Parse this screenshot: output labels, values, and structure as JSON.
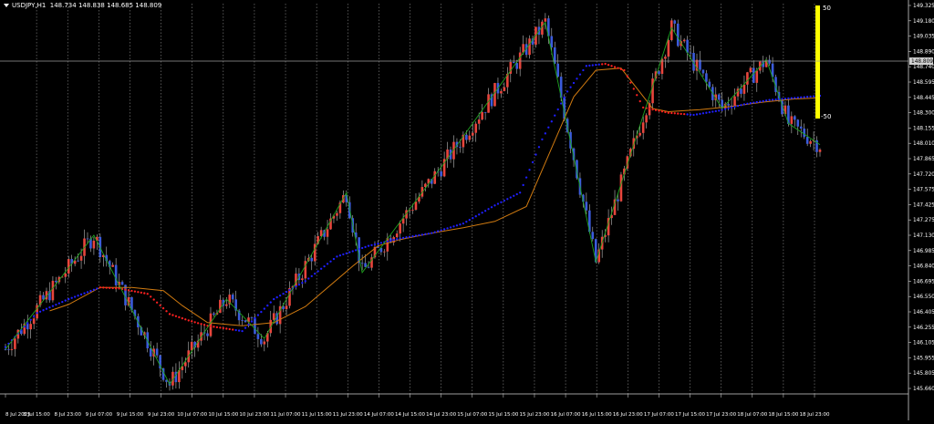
{
  "window": {
    "symbol": "USDJPY,H1",
    "ohlc_values": "148.734 148.838 148.685 148.809",
    "current_price_label": "148.809"
  },
  "indicator": {
    "top_label": "50",
    "bottom_label": "-50",
    "bar_color": "#ffff00"
  },
  "colors": {
    "background": "#000000",
    "bull": "#e8453c",
    "bear": "#3b5bdb",
    "zigzag": "#1fa31f",
    "ma_blue": "#1f1fff",
    "ma_red": "#ff2020",
    "ma_orange": "#d07a10"
  },
  "chart_data": {
    "type": "candlestick",
    "y_ticks": [
      "149.325",
      "149.180",
      "149.035",
      "148.890",
      "148.740",
      "148.595",
      "148.445",
      "148.300",
      "148.155",
      "148.010",
      "147.865",
      "147.720",
      "147.575",
      "147.425",
      "147.275",
      "147.130",
      "146.985",
      "146.840",
      "146.695",
      "146.550",
      "146.405",
      "146.255",
      "146.105",
      "145.955",
      "145.805",
      "145.660"
    ],
    "ylim": [
      145.66,
      149.325
    ],
    "x_ticks": [
      "8 Jul 2025",
      "8 Jul 15:00",
      "8 Jul 23:00",
      "9 Jul 07:00",
      "9 Jul 15:00",
      "9 Jul 23:00",
      "10 Jul 07:00",
      "10 Jul 15:00",
      "10 Jul 23:00",
      "11 Jul 07:00",
      "11 Jul 15:00",
      "11 Jul 23:00",
      "14 Jul 07:00",
      "14 Jul 15:00",
      "14 Jul 23:00",
      "15 Jul 07:00",
      "15 Jul 15:00",
      "15 Jul 23:00",
      "16 Jul 07:00",
      "16 Jul 15:00",
      "16 Jul 23:00",
      "17 Jul 07:00",
      "17 Jul 15:00",
      "17 Jul 23:00",
      "18 Jul 07:00",
      "18 Jul 15:00",
      "18 Jul 23:00"
    ],
    "zigzag": [
      [
        0,
        146.08
      ],
      [
        28,
        147.15
      ],
      [
        52,
        145.75
      ],
      [
        70,
        146.55
      ],
      [
        82,
        146.18
      ],
      [
        108,
        147.55
      ],
      [
        113,
        146.8
      ],
      [
        139,
        147.83
      ],
      [
        171,
        149.15
      ],
      [
        187,
        146.9
      ],
      [
        211,
        149.1
      ],
      [
        227,
        148.34
      ],
      [
        241,
        148.8
      ],
      [
        248,
        148.2
      ],
      [
        258,
        148.0
      ]
    ],
    "ma_long_start_index": 14,
    "ma_long": [
      [
        14,
        146.44
      ],
      [
        20,
        146.5
      ],
      [
        30,
        146.66
      ],
      [
        40,
        146.66
      ],
      [
        50,
        146.63
      ],
      [
        56,
        146.49
      ],
      [
        64,
        146.33
      ],
      [
        75,
        146.3
      ],
      [
        85,
        146.33
      ],
      [
        95,
        146.48
      ],
      [
        110,
        146.86
      ],
      [
        118,
        147.05
      ],
      [
        125,
        147.11
      ],
      [
        135,
        147.17
      ],
      [
        145,
        147.22
      ],
      [
        155,
        147.28
      ],
      [
        165,
        147.42
      ],
      [
        172,
        147.9
      ],
      [
        180,
        148.45
      ],
      [
        187,
        148.7
      ],
      [
        195,
        148.72
      ],
      [
        200,
        148.53
      ],
      [
        205,
        148.34
      ],
      [
        210,
        148.31
      ],
      [
        220,
        148.33
      ],
      [
        230,
        148.36
      ],
      [
        240,
        148.4
      ],
      [
        250,
        148.43
      ],
      [
        258,
        148.44
      ]
    ],
    "ma_short": [
      [
        0,
        146.1
      ],
      [
        10,
        146.42
      ],
      [
        20,
        146.55
      ],
      [
        30,
        146.66
      ],
      [
        36,
        146.65
      ],
      [
        45,
        146.6
      ],
      [
        52,
        146.41
      ],
      [
        58,
        146.35
      ],
      [
        64,
        146.3
      ],
      [
        75,
        146.25
      ],
      [
        85,
        146.55
      ],
      [
        95,
        146.72
      ],
      [
        105,
        146.95
      ],
      [
        115,
        147.05
      ],
      [
        125,
        147.12
      ],
      [
        135,
        147.17
      ],
      [
        145,
        147.26
      ],
      [
        155,
        147.43
      ],
      [
        163,
        147.55
      ],
      [
        170,
        148.05
      ],
      [
        178,
        148.5
      ],
      [
        184,
        148.74
      ],
      [
        190,
        148.76
      ],
      [
        196,
        148.7
      ],
      [
        202,
        148.35
      ],
      [
        210,
        148.3
      ],
      [
        218,
        148.28
      ],
      [
        226,
        148.32
      ],
      [
        234,
        148.38
      ],
      [
        242,
        148.42
      ],
      [
        250,
        148.44
      ],
      [
        258,
        148.46
      ]
    ],
    "candle_count": 259
  }
}
